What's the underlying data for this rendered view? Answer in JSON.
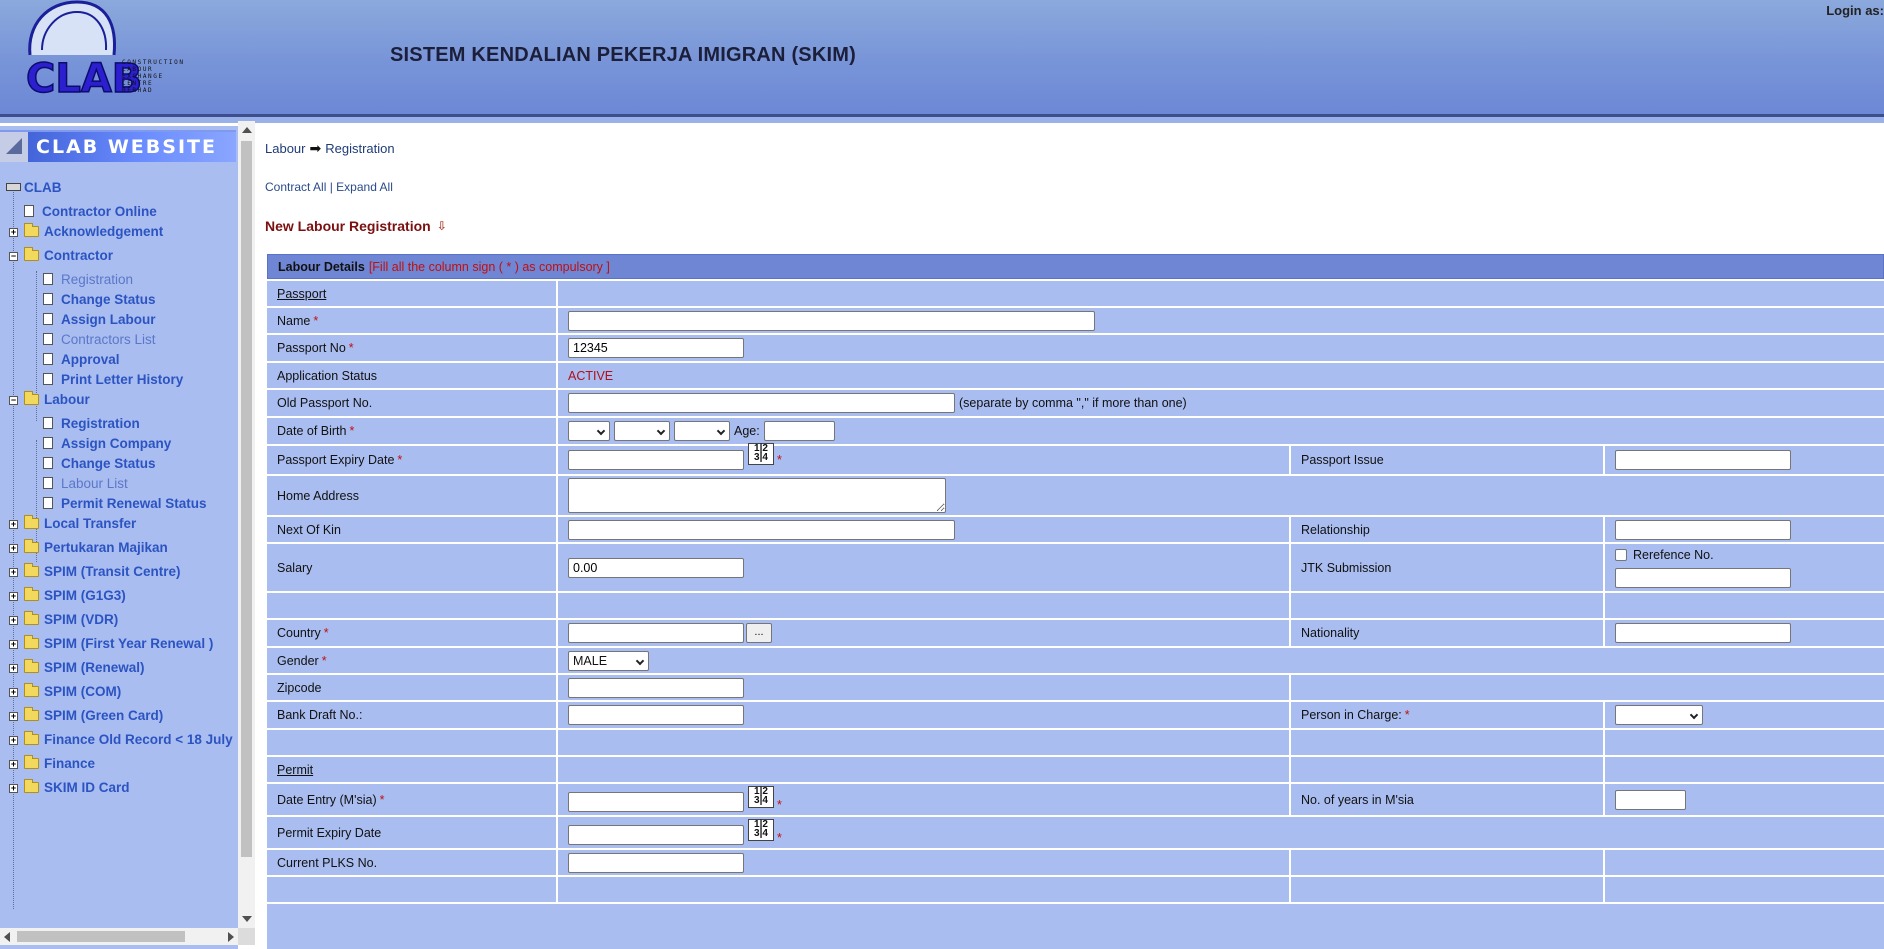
{
  "header": {
    "title": "SISTEM KENDALIAN PEKERJA IMIGRAN (SKIM)",
    "login_label": "Login as:",
    "logo_text": "CLAB",
    "logo_subtext": [
      "CONSTRUCTION",
      "LABOUR",
      "EXCHANGE",
      "CENTRE",
      "BERHAD"
    ]
  },
  "sidebar": {
    "banner": "CLAB WEBSITE",
    "root": "CLAB",
    "items": [
      {
        "label": "Contractor Online"
      },
      {
        "label": "Acknowledgement"
      },
      {
        "label": "Contractor"
      },
      {
        "label": "Registration"
      },
      {
        "label": "Change Status"
      },
      {
        "label": "Assign Labour"
      },
      {
        "label": "Contractors List"
      },
      {
        "label": "Approval"
      },
      {
        "label": "Print Letter History"
      },
      {
        "label": "Labour"
      },
      {
        "label": "Registration"
      },
      {
        "label": "Assign Company"
      },
      {
        "label": "Change Status"
      },
      {
        "label": "Labour List"
      },
      {
        "label": "Permit Renewal Status"
      },
      {
        "label": "Local Transfer"
      },
      {
        "label": "Pertukaran Majikan"
      },
      {
        "label": "SPIM (Transit Centre)"
      },
      {
        "label": "SPIM (G1G3)"
      },
      {
        "label": "SPIM (VDR)"
      },
      {
        "label": "SPIM (First Year Renewal )"
      },
      {
        "label": "SPIM (Renewal)"
      },
      {
        "label": "SPIM (COM)"
      },
      {
        "label": "SPIM (Green Card)"
      },
      {
        "label": "Finance Old Record < 18 July"
      },
      {
        "label": "Finance"
      },
      {
        "label": "SKIM ID Card"
      }
    ]
  },
  "main": {
    "breadcrumb": {
      "parent": "Labour",
      "current": "Registration"
    },
    "contract_all": "Contract All",
    "separator": "|",
    "expand_all": "Expand All",
    "section_title": "New Labour Registration",
    "form_header": {
      "label": "Labour Details",
      "note": "[Fill all the column sign ( * ) as compulsory ]"
    },
    "star": "*",
    "fields": {
      "passport_section": "Passport",
      "name": "Name",
      "passport_no": "Passport No",
      "passport_no_value": "12345",
      "application_status": "Application Status",
      "application_status_value": "ACTIVE",
      "old_passport": "Old Passport No.",
      "old_passport_hint": "(separate by comma \",\" if more than one)",
      "dob": "Date of Birth",
      "age": "Age:",
      "passport_expiry": "Passport Expiry Date",
      "passport_issue": "Passport Issue",
      "home_address": "Home Address",
      "next_of_kin": "Next Of Kin",
      "relationship": "Relationship",
      "salary": "Salary",
      "salary_value": "0.00",
      "jtk_submission": "JTK Submission",
      "reference_no": "Rerefence No.",
      "country": "Country",
      "country_button": "...",
      "nationality": "Nationality",
      "gender": "Gender",
      "gender_value": "MALE",
      "zipcode": "Zipcode",
      "bank_draft": "Bank Draft No.:",
      "person_in_charge": "Person in Charge:",
      "permit_section": "Permit",
      "date_entry": "Date Entry (M'sia)",
      "years_in_msia": "No. of years in M'sia",
      "permit_expiry": "Permit Expiry Date",
      "current_plks": "Current PLKS No."
    },
    "calendar_icon": "1|2"
  },
  "colors": {
    "header_bg": "#7894d8",
    "sidebar_bg": "#aabdf0",
    "form_row_bg": "#aabdf0",
    "form_header_bg": "#6f86d4",
    "required": "#c01010",
    "title_red": "#7a1010",
    "link_blue": "#2b54c2"
  }
}
